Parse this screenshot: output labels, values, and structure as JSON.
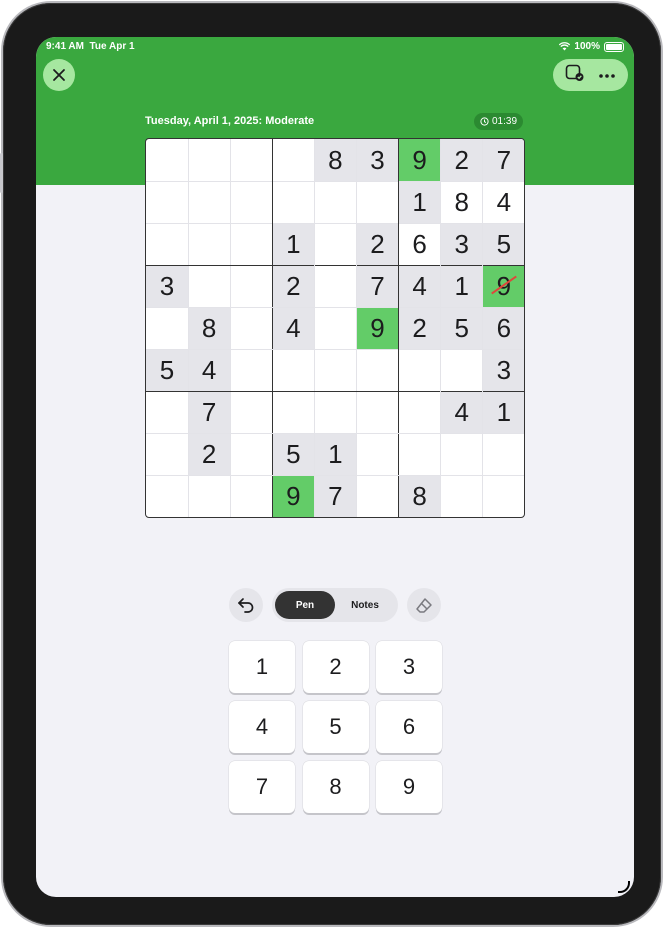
{
  "status_bar": {
    "time": "9:41 AM",
    "date": "Tue Apr 1",
    "battery": "100%"
  },
  "header": {
    "title": "Tuesday, April 1, 2025: Moderate",
    "timer": "01:39",
    "accent_color": "#3aa83f"
  },
  "board": {
    "rows": [
      [
        "",
        "",
        "",
        "",
        "8",
        "3",
        "9",
        "2",
        "7"
      ],
      [
        "",
        "",
        "",
        "",
        "",
        "",
        "1",
        "8",
        "4"
      ],
      [
        "",
        "",
        "",
        "1",
        "",
        "2",
        "6",
        "3",
        "5"
      ],
      [
        "3",
        "",
        "",
        "2",
        "",
        "7",
        "4",
        "1",
        "9"
      ],
      [
        "",
        "8",
        "",
        "4",
        "",
        "9",
        "2",
        "5",
        "6"
      ],
      [
        "5",
        "4",
        "",
        "",
        "",
        "",
        "",
        "",
        "3"
      ],
      [
        "",
        "7",
        "",
        "",
        "",
        "",
        "",
        "4",
        "1"
      ],
      [
        "",
        "2",
        "",
        "5",
        "1",
        "",
        "",
        "",
        ""
      ],
      [
        "",
        "",
        "",
        "9",
        "7",
        "",
        "8",
        "",
        ""
      ]
    ],
    "given": [
      [
        0,
        4
      ],
      [
        0,
        5
      ],
      [
        0,
        7
      ],
      [
        0,
        8
      ],
      [
        1,
        6
      ],
      [
        2,
        3
      ],
      [
        2,
        5
      ],
      [
        2,
        7
      ],
      [
        2,
        8
      ],
      [
        3,
        0
      ],
      [
        3,
        3
      ],
      [
        3,
        5
      ],
      [
        3,
        6
      ],
      [
        3,
        7
      ],
      [
        4,
        1
      ],
      [
        4,
        3
      ],
      [
        4,
        6
      ],
      [
        4,
        7
      ],
      [
        4,
        8
      ],
      [
        5,
        0
      ],
      [
        5,
        1
      ],
      [
        5,
        8
      ],
      [
        6,
        1
      ],
      [
        6,
        7
      ],
      [
        6,
        8
      ],
      [
        7,
        1
      ],
      [
        7,
        3
      ],
      [
        7,
        4
      ],
      [
        8,
        4
      ],
      [
        8,
        6
      ]
    ],
    "highlighted": [
      [
        0,
        6
      ],
      [
        3,
        8
      ],
      [
        4,
        5
      ],
      [
        8,
        3
      ]
    ],
    "struck": [
      [
        3,
        8
      ]
    ]
  },
  "controls": {
    "undo_icon": "undo-icon",
    "mode_pen": "Pen",
    "mode_notes": "Notes",
    "active_mode": "Pen",
    "eraser_icon": "eraser-icon"
  },
  "keypad": [
    "1",
    "2",
    "3",
    "4",
    "5",
    "6",
    "7",
    "8",
    "9"
  ]
}
